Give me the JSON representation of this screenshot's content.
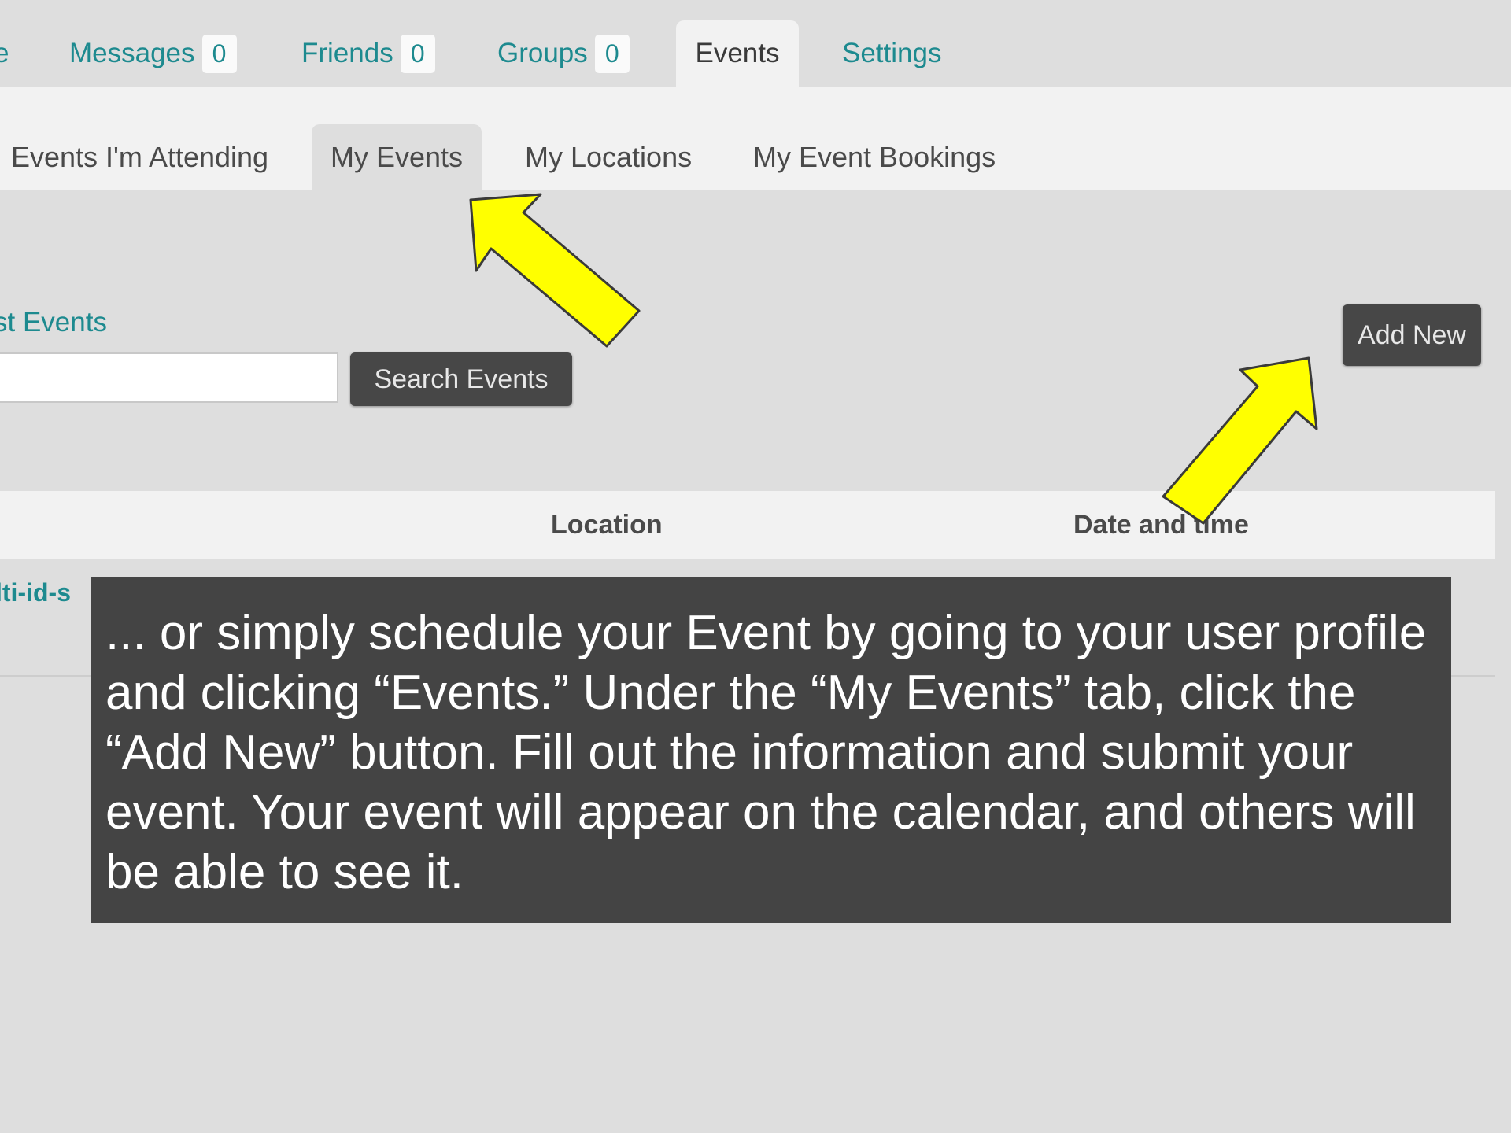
{
  "primary_tabs": {
    "partial_left": "e",
    "messages": {
      "label": "Messages",
      "count": "0"
    },
    "friends": {
      "label": "Friends",
      "count": "0"
    },
    "groups": {
      "label": "Groups",
      "count": "0"
    },
    "events": {
      "label": "Events"
    },
    "settings": {
      "label": "Settings"
    }
  },
  "secondary_tabs": {
    "attending": "Events I'm Attending",
    "my_events": "My Events",
    "my_locations": "My Locations",
    "my_bookings": "My Event Bookings"
  },
  "content": {
    "section_title": "st Events",
    "search_button": "Search Events",
    "add_new_button": "Add New",
    "table_headers": {
      "location": "Location",
      "date_time": "Date and time"
    },
    "row_link_fragment": "lti-id-s"
  },
  "callout": {
    "text": "... or simply schedule your Event by going to your user profile and clicking “Events.” Under the “My Events” tab, click the “Add New” button. Fill out the information and submit your event. Your event will appear on the calendar, and others will be able to see it."
  },
  "colors": {
    "link_teal": "#1d8a8f",
    "arrow_fill": "#ffff00",
    "callout_bg": "#444444",
    "button_bg": "#474747"
  }
}
